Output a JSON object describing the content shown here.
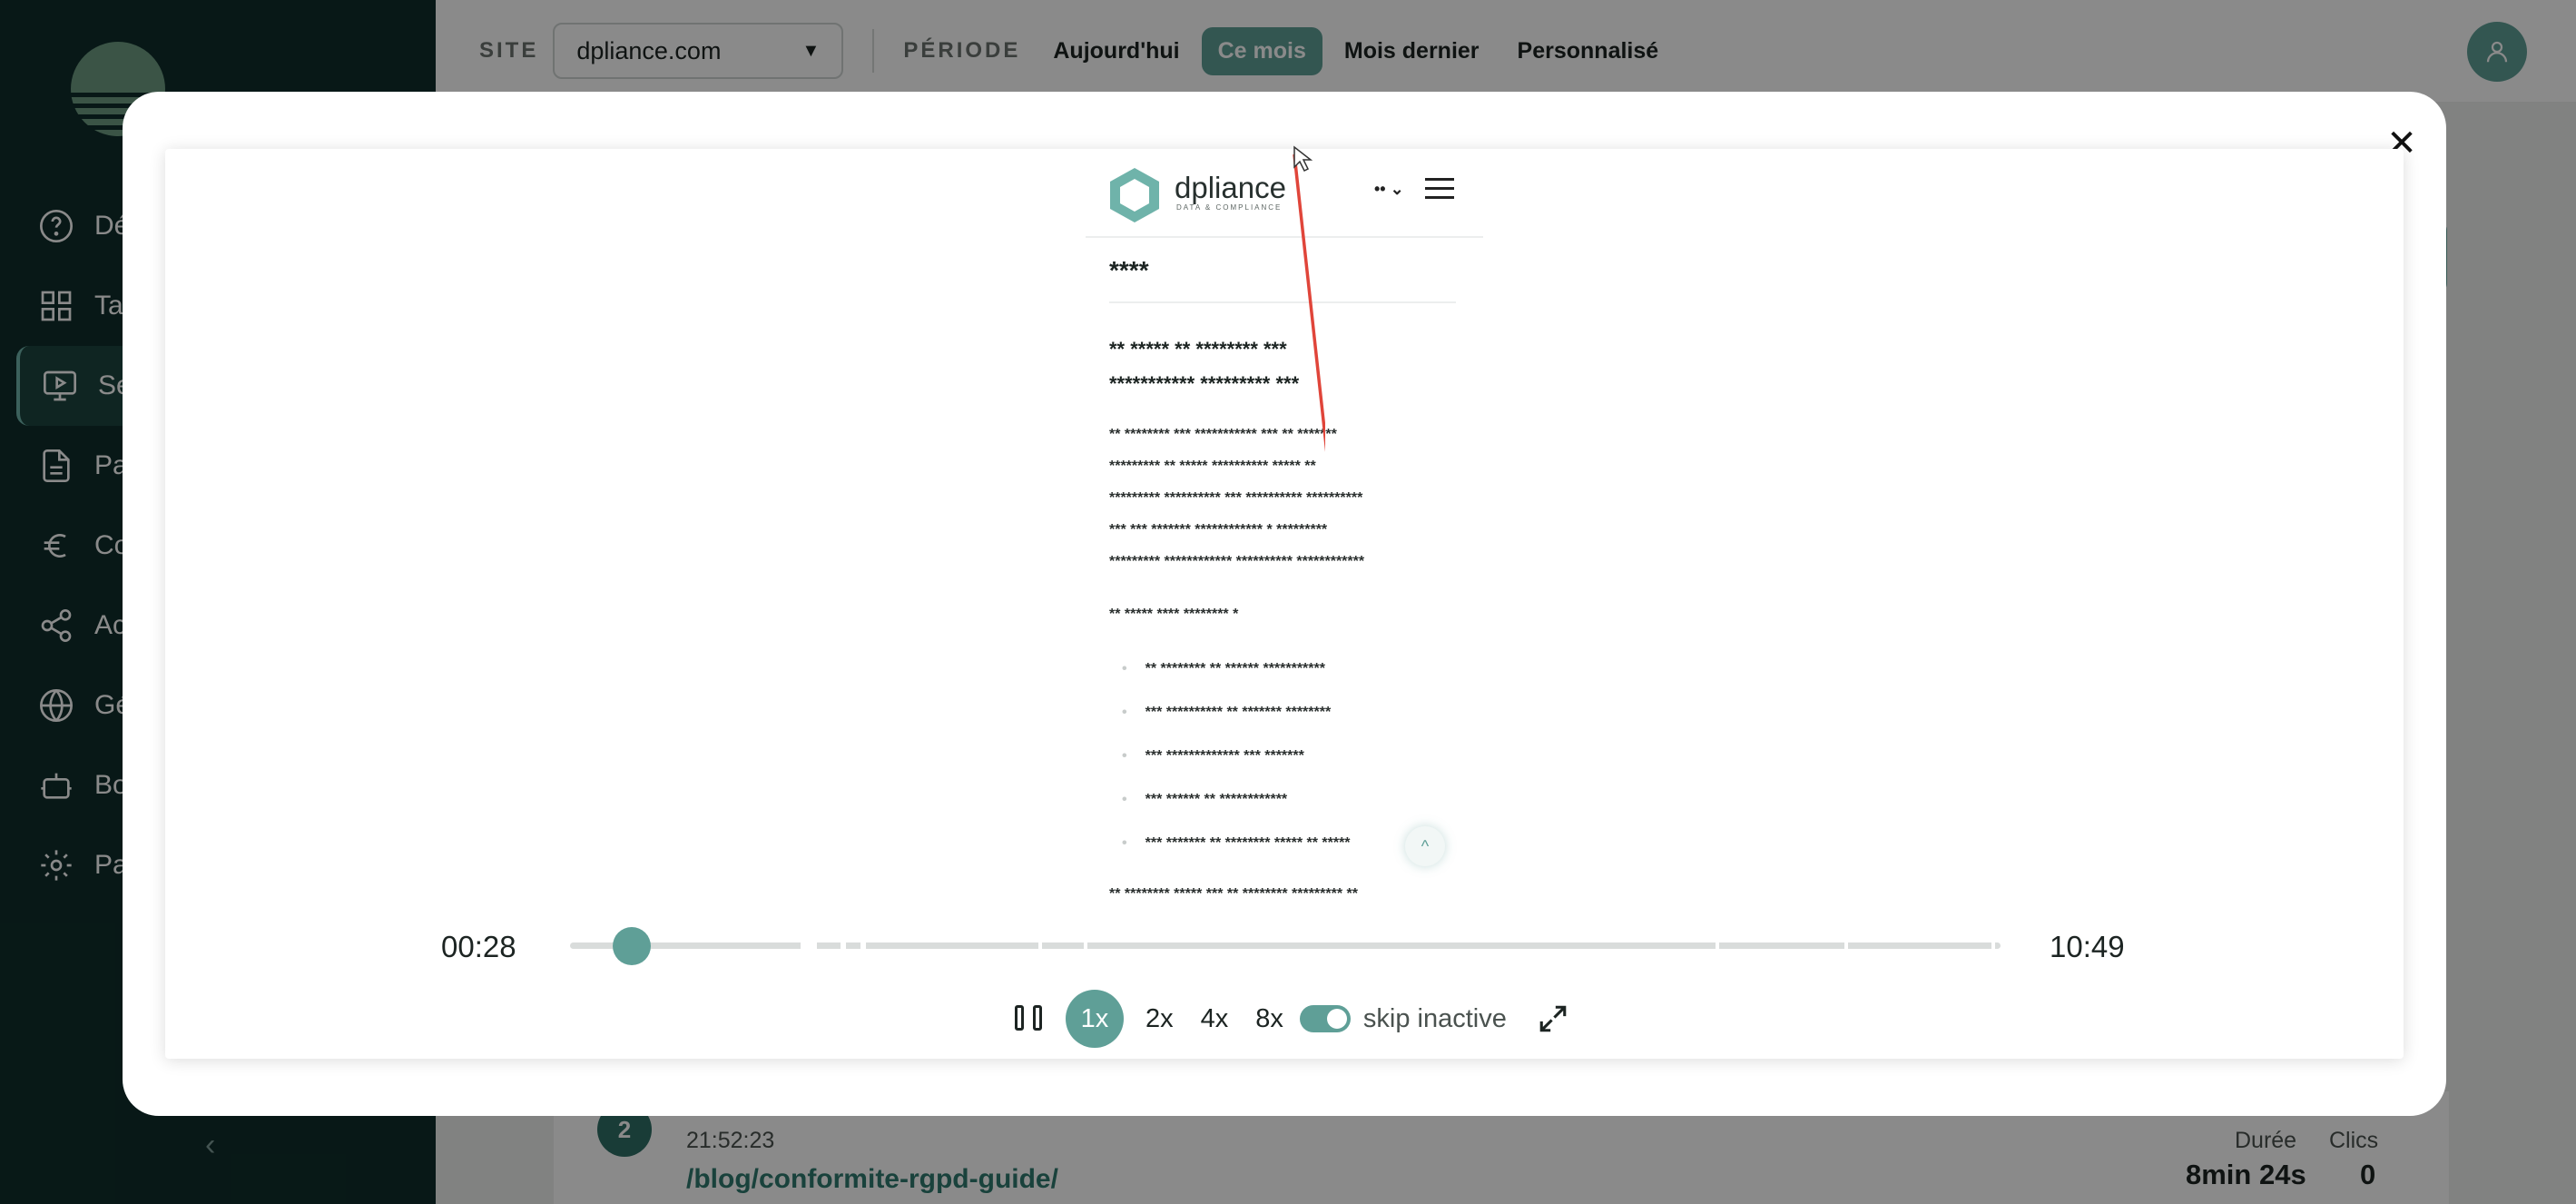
{
  "app": {
    "brand": "mirage",
    "nav": [
      {
        "icon": "help-circle-icon",
        "label": "Dé"
      },
      {
        "icon": "grid-icon",
        "label": "Ta"
      },
      {
        "icon": "monitor-play-icon",
        "label": "Se"
      },
      {
        "icon": "document-icon",
        "label": "Pa"
      },
      {
        "icon": "euro-icon",
        "label": "Co"
      },
      {
        "icon": "share-icon",
        "label": "Ac"
      },
      {
        "icon": "globe-icon",
        "label": "Gé"
      },
      {
        "icon": "bot-icon",
        "label": "Bo"
      },
      {
        "icon": "gear-icon",
        "label": "Pa"
      }
    ],
    "collapse_icon": "chevron-left-icon"
  },
  "topbar": {
    "site_label": "SITE",
    "site_value": "dpliance.com",
    "period_label": "PÉRIODE",
    "periods": [
      "Aujourd'hui",
      "Ce mois",
      "Mois dernier",
      "Personnalisé"
    ],
    "active_period": "Ce mois",
    "accent": "#5f9f97"
  },
  "session_row": {
    "index": "2",
    "time": "21:52:23",
    "path": "/blog/conformite-rgpd-guide/",
    "duration_label": "Durée",
    "duration_value": "8min 24s",
    "clicks_label": "Clics",
    "clicks_value": "0"
  },
  "replay": {
    "page": {
      "brand": "dpliance",
      "tagline": "DATA & COMPLIANCE",
      "lang": "••",
      "title": "****",
      "heading_lines": [
        "** ***** ** ******** ***",
        "*********** ********* ***"
      ],
      "paragraph_lines": [
        "** ******** *** *********** *** ** *******",
        "********* ** ***** ********** ***** **",
        "********* ********** *** ********** **********",
        "*** *** ******* ************ * *********",
        "********* ************ ********** ************"
      ],
      "subheading": "** ***** **** ******** *",
      "list_items": [
        "** ******** ** ****** ***********",
        "*** ********** ** ******* ********",
        "*** ************* *** *******",
        "*** ****** ** ************",
        "*** ******* ** ******** ***** ** *****"
      ],
      "footer_line": "** ******** ***** *** ** ******** ********* **"
    },
    "current_time": "00:28",
    "total_time": "10:49",
    "progress": 0.043,
    "speeds": [
      "1x",
      "2x",
      "4x",
      "8x"
    ],
    "active_speed": "1x",
    "skip_inactive_label": "skip inactive",
    "skip_inactive": true
  }
}
